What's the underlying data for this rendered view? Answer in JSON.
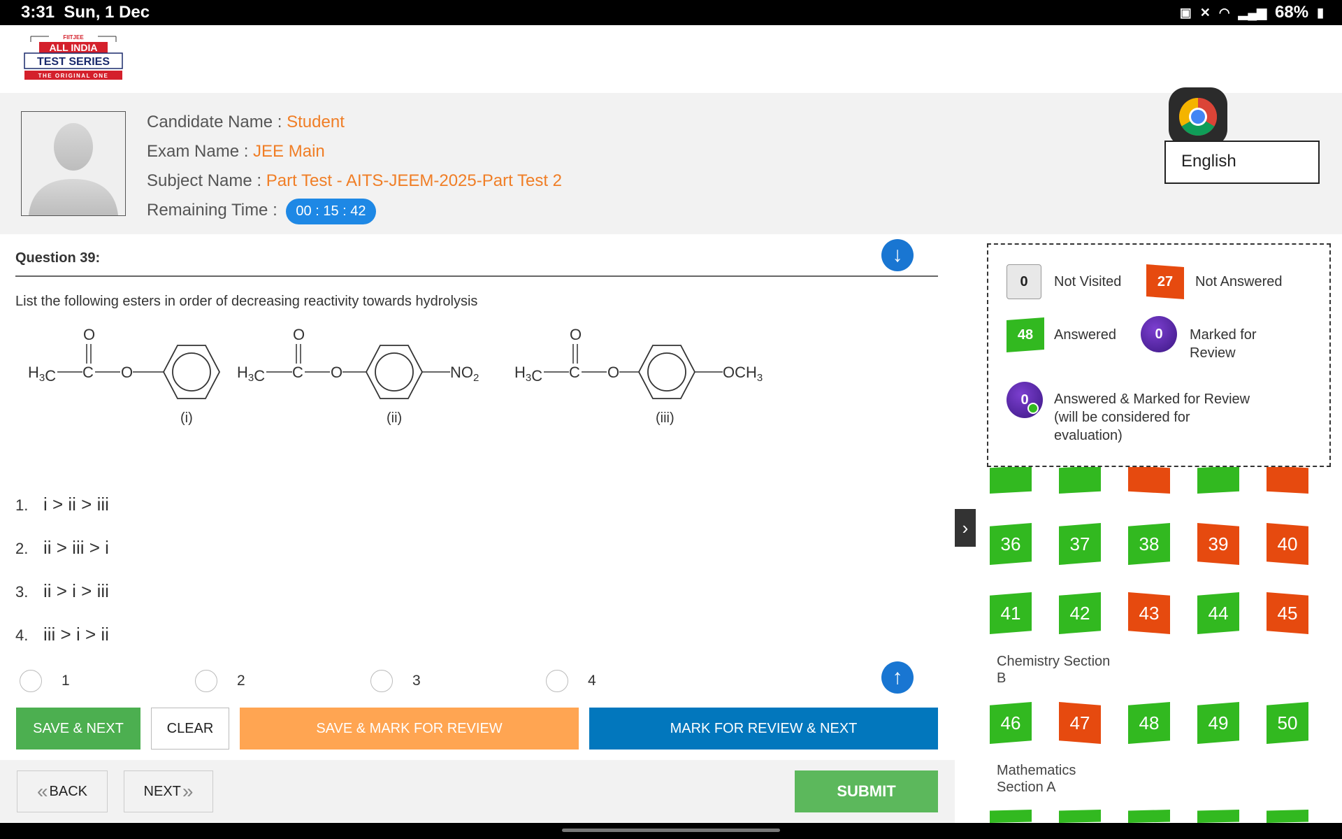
{
  "status_bar": {
    "time": "3:31",
    "date": "Sun, 1 Dec",
    "battery": "68%"
  },
  "logo": {
    "top": "FIITJEE",
    "line1": "ALL INDIA",
    "line2": "TEST SERIES",
    "tagline": "THE ORIGINAL ONE"
  },
  "candidate": {
    "name_label": "Candidate Name :",
    "name": "Student",
    "exam_label": "Exam Name :",
    "exam": "JEE Main",
    "subject_label": "Subject Name :",
    "subject": "Part Test - AITS-JEEM-2025-Part Test 2",
    "time_label": "Remaining Time :",
    "time": "00 : 15 : 42"
  },
  "language": "English",
  "question": {
    "title": "Question 39:",
    "text": "List the following esters in order of decreasing reactivity towards hydrolysis",
    "structures": {
      "o": "O",
      "c": "C",
      "h3c": "H3C",
      "no2": "NO2",
      "och3": "OCH3",
      "labels": [
        "(i)",
        "(ii)",
        "(iii)"
      ]
    },
    "options": [
      {
        "num": "1.",
        "text": "i > ii > iii"
      },
      {
        "num": "2.",
        "text": "ii > iii > i"
      },
      {
        "num": "3.",
        "text": "ii > i > iii"
      },
      {
        "num": "4.",
        "text": "iii > i > ii"
      }
    ],
    "radio_labels": [
      "1",
      "2",
      "3",
      "4"
    ]
  },
  "buttons": {
    "save_next": "SAVE & NEXT",
    "clear": "CLEAR",
    "save_mark": "SAVE & MARK FOR REVIEW",
    "mark_next": "MARK FOR REVIEW & NEXT",
    "back": "BACK",
    "next": "NEXT",
    "submit": "SUBMIT",
    "back_chevron": "«",
    "next_chevron": "»"
  },
  "legend": {
    "not_visited": {
      "count": "0",
      "label": "Not Visited"
    },
    "not_answered": {
      "count": "27",
      "label": "Not Answered"
    },
    "answered": {
      "count": "48",
      "label": "Answered"
    },
    "marked": {
      "count": "0",
      "label_line1": "Marked for",
      "label_line2": "Review"
    },
    "answered_marked": {
      "count": "0",
      "label_line1": "Answered & Marked for Review",
      "label_line2": "(will be considered for",
      "label_line3": "evaluation)"
    }
  },
  "palette": {
    "row_a": [
      {
        "n": "36",
        "status": "answered"
      },
      {
        "n": "37",
        "status": "answered"
      },
      {
        "n": "38",
        "status": "answered"
      },
      {
        "n": "39",
        "status": "not-answered"
      },
      {
        "n": "40",
        "status": "not-answered"
      }
    ],
    "row_b": [
      {
        "n": "41",
        "status": "answered"
      },
      {
        "n": "42",
        "status": "answered"
      },
      {
        "n": "43",
        "status": "not-answered"
      },
      {
        "n": "44",
        "status": "answered"
      },
      {
        "n": "45",
        "status": "not-answered"
      }
    ],
    "section_chem_b_line1": "Chemistry Section",
    "section_chem_b_line2": "B",
    "row_c": [
      {
        "n": "46",
        "status": "answered"
      },
      {
        "n": "47",
        "status": "not-answered"
      },
      {
        "n": "48",
        "status": "answered"
      },
      {
        "n": "49",
        "status": "answered"
      },
      {
        "n": "50",
        "status": "answered"
      }
    ],
    "section_math_a_line1": "Mathematics",
    "section_math_a_line2": "Section A"
  },
  "colors": {
    "answered": "#32b920",
    "not_answered": "#e64a0f",
    "accent": "#f07e26",
    "timer": "#1e88e5"
  }
}
